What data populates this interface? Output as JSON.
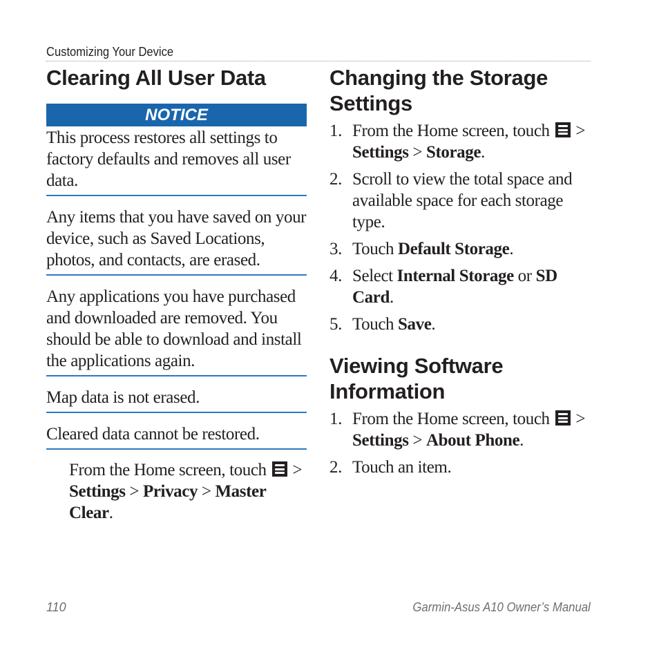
{
  "running_head": "Customizing Your Device",
  "left": {
    "title": "Clearing All User Data",
    "notice_label": "NOTICE",
    "notice_text": "This process restores all settings to factory defaults and removes all user data.",
    "blocks": [
      "Any items that you have saved on your device, such as Saved Locations, photos, and contacts, are erased.",
      "Any applications you have purchased and downloaded are removed. You should be able to download and install the applications again.",
      "Map data is not erased.",
      "Cleared data cannot be restored."
    ],
    "step": {
      "prefix": "From the Home screen, touch",
      "icon": "menu-icon",
      "sep": ">",
      "path": [
        "Settings",
        "Privacy",
        "Master Clear"
      ],
      "end": "."
    }
  },
  "right": {
    "sections": [
      {
        "title": "Changing the Storage Settings",
        "steps": [
          {
            "num": "1.",
            "prefix": "From the Home screen, touch",
            "icon": "menu-icon",
            "path": [
              "Settings",
              "Storage"
            ]
          },
          {
            "num": "2.",
            "text": "Scroll to view the total space and available space for each storage type."
          },
          {
            "num": "3.",
            "pre": "Touch ",
            "bold": "Default Storage",
            "post": "."
          },
          {
            "num": "4.",
            "pre": "Select ",
            "bold": "Internal Storage",
            "mid": " or ",
            "bold2": "SD Card",
            "post": "."
          },
          {
            "num": "5.",
            "pre": "Touch ",
            "bold": "Save",
            "post": "."
          }
        ]
      },
      {
        "title": "Viewing Software Information",
        "steps": [
          {
            "num": "1.",
            "prefix": "From the Home screen, touch",
            "icon": "menu-icon",
            "path": [
              "Settings",
              "About Phone"
            ]
          },
          {
            "num": "2.",
            "text": "Touch an item."
          }
        ]
      }
    ]
  },
  "footer": {
    "page_number": "110",
    "manual_title": "Garmin-Asus A10 Owner’s Manual"
  },
  "colors": {
    "notice_bg": "#1a66ad",
    "rule": "#2f77bf",
    "text": "#231f20",
    "footer": "#6d6e71"
  }
}
